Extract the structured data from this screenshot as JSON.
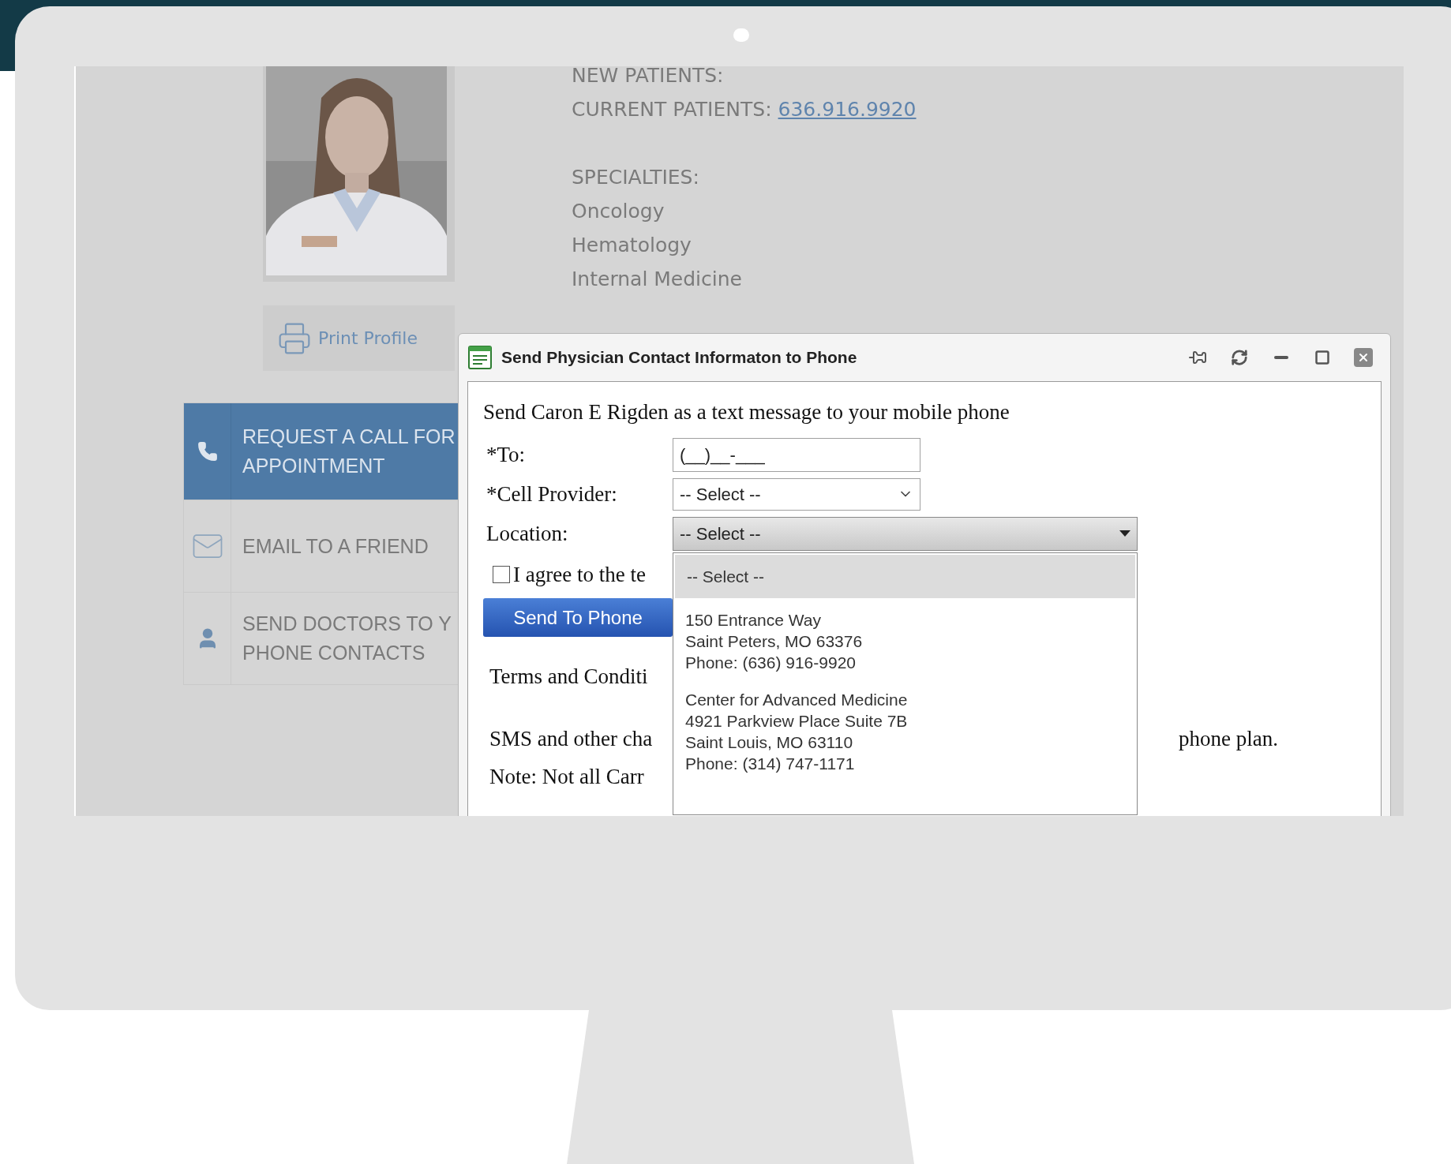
{
  "screen": {
    "profile": {
      "print_button": "Print Profile"
    },
    "contact": {
      "new_patients_label": "NEW PATIENTS:",
      "current_patients_label": "CURRENT PATIENTS:",
      "current_patients_phone": "636.916.9920",
      "specialties_label": "SPECIALTIES:",
      "specialties": [
        "Oncology",
        "Hematology",
        "Internal Medicine"
      ]
    },
    "sidebar": {
      "items": [
        {
          "kind": "phone",
          "lines": [
            "REQUEST A CALL FOR",
            "APPOINTMENT"
          ],
          "selected": true
        },
        {
          "kind": "email",
          "lines": [
            "EMAIL TO A FRIEND"
          ],
          "selected": false
        },
        {
          "kind": "person",
          "lines": [
            "SEND DOCTORS TO Y",
            "PHONE CONTACTS"
          ],
          "selected": false
        }
      ]
    },
    "dialog": {
      "title": "Send Physician Contact Informaton to Phone",
      "heading": "Send Caron E Rigden as a text message to your mobile phone",
      "fields": [
        {
          "kind": "text",
          "label": "*To:",
          "value": "(__)__-___"
        },
        {
          "kind": "select",
          "label": "*Cell Provider:",
          "value": "-- Select --"
        },
        {
          "kind": "combo",
          "label": "Location:",
          "value": "-- Select --",
          "expanded": true
        }
      ],
      "agree": {
        "label": "I agree to the te",
        "checked": false
      },
      "send_button": "Send To Phone",
      "terms": "Terms and Conditi",
      "sms": [
        "SMS and other cha",
        "phone plan."
      ],
      "note": "Note: Not all Carr",
      "dropdown_options": [
        {
          "lines": [
            "-- Select --"
          ],
          "selected": true
        },
        {
          "lines": [
            "150 Entrance Way",
            "Saint Peters, MO 63376",
            "Phone: (636) 916-9920"
          ],
          "selected": false
        },
        {
          "lines": [
            "Center for Advanced Medicine",
            "4921 Parkview Place Suite 7B",
            "Saint Louis, MO 63110",
            "Phone: (314) 747-1171"
          ],
          "selected": false
        }
      ]
    }
  }
}
